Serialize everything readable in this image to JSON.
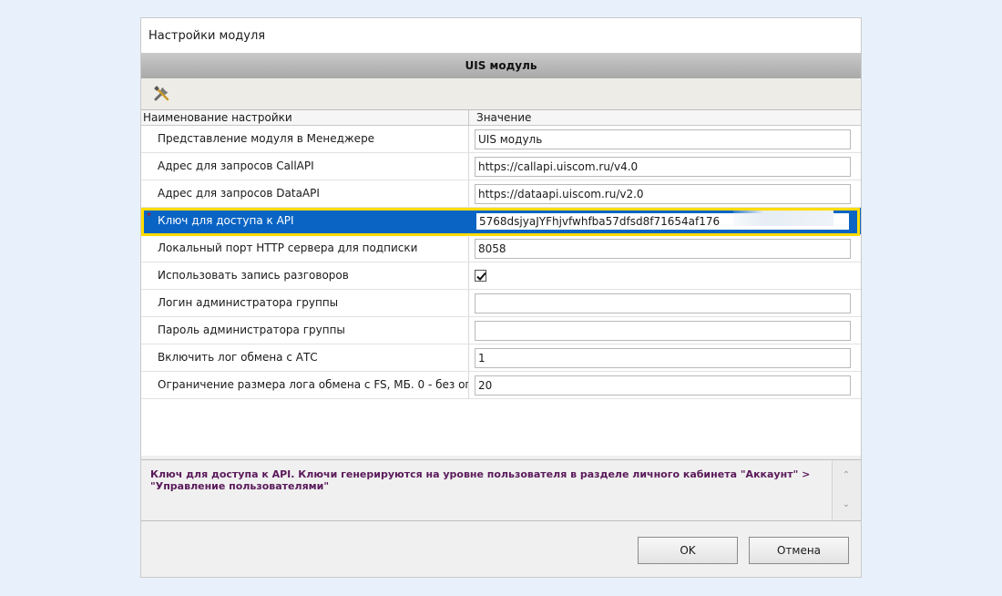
{
  "window": {
    "title": "Настройки модуля"
  },
  "module": {
    "header": "UIS модуль"
  },
  "toolbar": {
    "tool_icon": "tools-icon"
  },
  "grid": {
    "columns": {
      "name": "Наименование настройки",
      "value": "Значение"
    },
    "rows": [
      {
        "name": "Представление модуля в Менеджере",
        "value": "UIS модуль",
        "type": "text"
      },
      {
        "name": "Адрес для запросов CallAPI",
        "value": "https://callapi.uiscom.ru/v4.0",
        "type": "text"
      },
      {
        "name": "Адрес для запросов DataAPI",
        "value": "https://dataapi.uiscom.ru/v2.0",
        "type": "text"
      },
      {
        "name": "Ключ для доступа к API",
        "value": "5768dsjyaJYFhjvfwhfba57dfsd8f71654af176",
        "type": "text",
        "selected": true,
        "required": true
      },
      {
        "name": "Локальный порт HTTP сервера для подписки",
        "value": "8058",
        "type": "text"
      },
      {
        "name": "Использовать запись разговоров",
        "value": "",
        "type": "checkbox",
        "checked": true
      },
      {
        "name": "Логин администратора группы",
        "value": "",
        "type": "text"
      },
      {
        "name": "Пароль администратора группы",
        "value": "",
        "type": "text"
      },
      {
        "name": "Включить лог обмена с АТС",
        "value": "1",
        "type": "text"
      },
      {
        "name": "Ограничение размера лога обмена с FS, МБ. 0 - без ог",
        "value": "20",
        "type": "text"
      }
    ]
  },
  "description": "Ключ для доступа к API. Ключи генерируются на уровне пользователя в разделе личного кабинета \"Аккаунт\" > \"Управление пользователями\"",
  "buttons": {
    "ok": "OK",
    "cancel": "Отмена"
  },
  "colors": {
    "selection": "#0a64c4",
    "highlight": "#ffdc00",
    "description_text": "#5a1a5a"
  }
}
